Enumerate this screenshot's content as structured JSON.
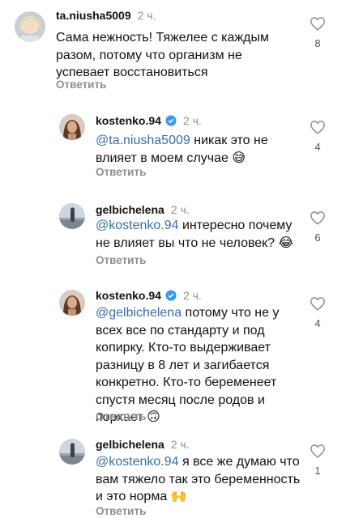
{
  "comments": [
    {
      "username": "ta.niusha5009",
      "time": "2 ч.",
      "mention": "",
      "text": "Сама нежность! Тяжелее с каждым разом, потому что организм не успевает восстановиться",
      "reply_label": "Ответить",
      "likes": "8",
      "avatar": "blonde-woman-avatar"
    },
    {
      "username": "kostenko.94",
      "time": "2 ч.",
      "verified": true,
      "mention": "@ta.niusha5009",
      "text": " никак это не влияет в моем случае 😅",
      "reply_label": "Ответить",
      "likes": "4",
      "avatar": "woman-portrait-avatar"
    },
    {
      "username": "gelbichelena",
      "time": "2 ч.",
      "mention": "@kostenko.94",
      "text": " интересно почему не влияет вы что не человек? 😂",
      "reply_label": "Ответить",
      "likes": "6",
      "avatar": "seaside-person-avatar"
    },
    {
      "username": "kostenko.94",
      "time": "2 ч.",
      "verified": true,
      "mention": "@gelbichelena",
      "text": " потому что не у всех все по стандарту и под копирку. Кто-то выдерживает разницу в 8 лет и загибается конкретно. Кто-то беременеет спустя месяц после родов и порхает 🙃",
      "reply_label": "Ответить",
      "likes": "4",
      "avatar": "woman-portrait-avatar"
    },
    {
      "username": "gelbichelena",
      "time": "2 ч.",
      "mention": "@kostenko.94",
      "text": " я все же думаю что вам тяжело так это беременность и это норма 🙌",
      "reply_label": "Ответить",
      "likes": "1",
      "avatar": "seaside-person-avatar"
    }
  ],
  "colors": {
    "mention": "#3b6ea8",
    "verified": "#3897f0",
    "muted": "#8e8e8e"
  }
}
